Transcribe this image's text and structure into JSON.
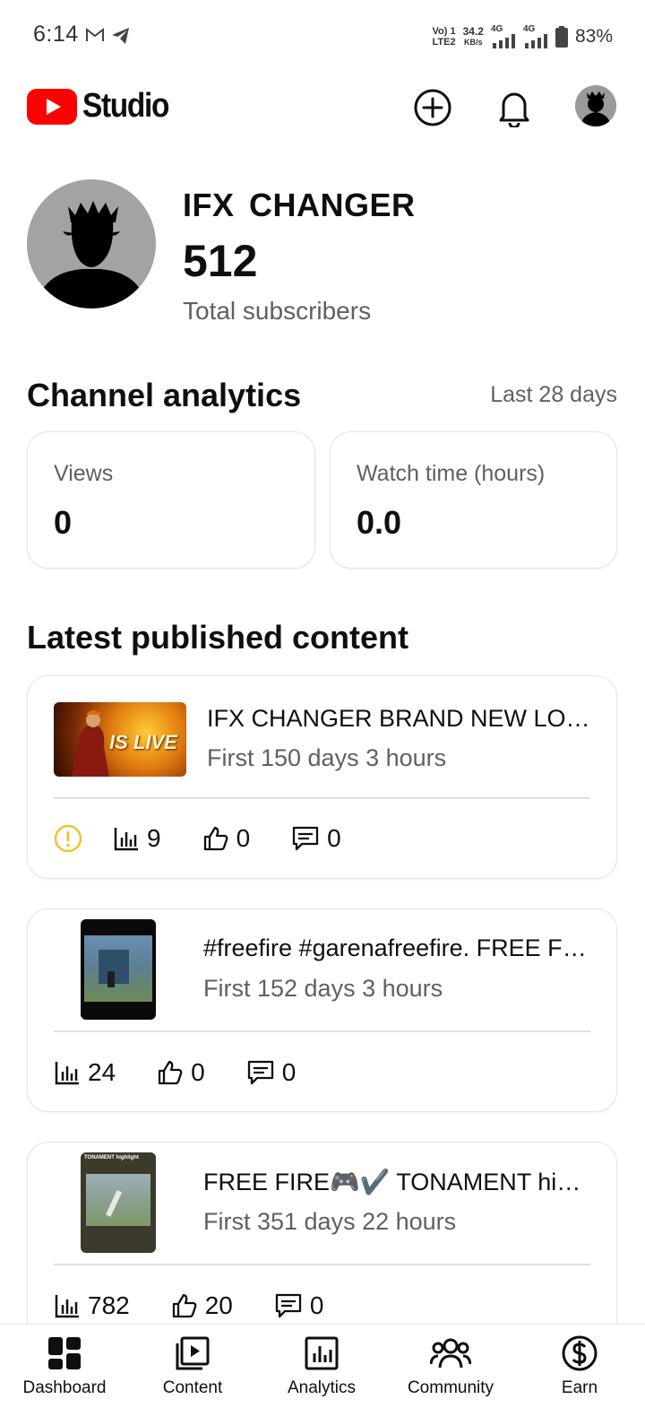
{
  "status_bar": {
    "time": "6:14",
    "net_type_top": "Vo) 1",
    "net_type_bottom": "LTE2",
    "speed_value": "34.2",
    "speed_unit": "KB/s",
    "sig1_label": "4G",
    "sig2_label": "4G",
    "battery": "83%"
  },
  "app_bar": {
    "logo_text": "Studio",
    "brand_color": "#ff0000"
  },
  "channel": {
    "name": "IFX  CHANGER",
    "subscribers": "512",
    "subscribers_label": "Total subscribers"
  },
  "analytics": {
    "title": "Channel analytics",
    "period": "Last 28 days",
    "cards": [
      {
        "label": "Views",
        "value": "0"
      },
      {
        "label": "Watch time (hours)",
        "value": "0.0"
      }
    ]
  },
  "latest": {
    "title": "Latest published content",
    "items": [
      {
        "title": "IFX  CHANGER  BRAND NEW LOOK",
        "subtitle": "First 150 days 3 hours",
        "views": "9",
        "likes": "0",
        "comments": "0",
        "warning": true,
        "thumb_text": "IS LIVE"
      },
      {
        "title": "#freefire #garenafreefire. FREE FIRE",
        "subtitle": "First 152 days 3 hours",
        "views": "24",
        "likes": "0",
        "comments": "0",
        "warning": false
      },
      {
        "title": "FREE FIRE🎮✔️ TONAMENT highlight",
        "subtitle": "First 351 days 22 hours",
        "views": "782",
        "likes": "20",
        "comments": "0",
        "warning": false,
        "thumb_text": "TONAMENT highlight"
      }
    ]
  },
  "bottom_nav": [
    {
      "label": "Dashboard",
      "icon": "dashboard-icon"
    },
    {
      "label": "Content",
      "icon": "content-icon"
    },
    {
      "label": "Analytics",
      "icon": "analytics-icon"
    },
    {
      "label": "Community",
      "icon": "community-icon"
    },
    {
      "label": "Earn",
      "icon": "earn-icon"
    }
  ],
  "colors": {
    "warning": "#f2c230",
    "secondary_text": "#606060"
  }
}
